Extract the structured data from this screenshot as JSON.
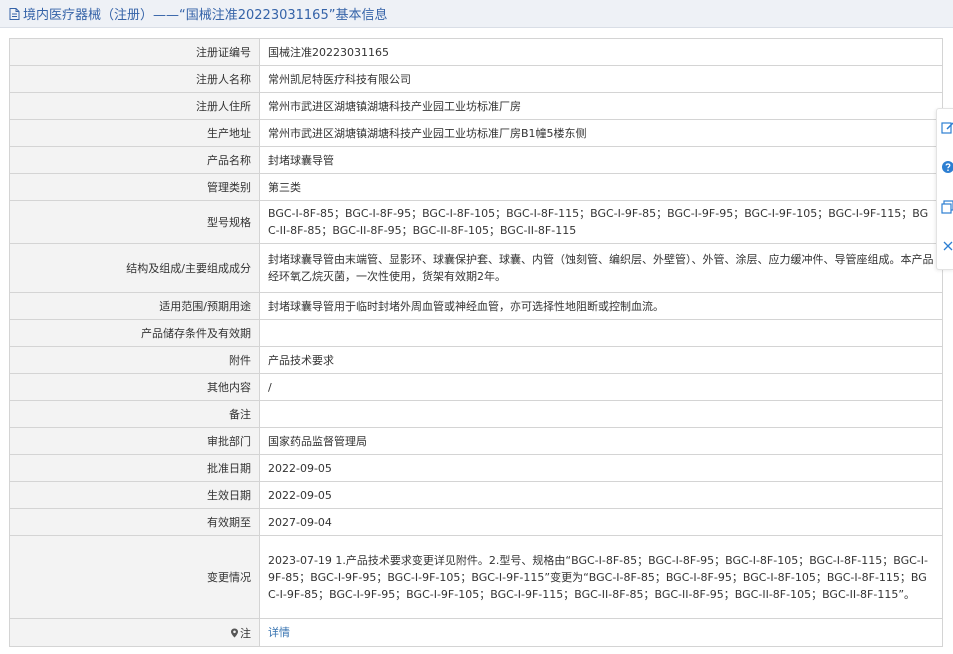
{
  "header": {
    "title": "境内医疗器械（注册）——“国械注准20223031165”基本信息"
  },
  "rows": [
    {
      "label": "注册证编号",
      "value": "国械注准20223031165"
    },
    {
      "label": "注册人名称",
      "value": "常州凯尼特医疗科技有限公司"
    },
    {
      "label": "注册人住所",
      "value": "常州市武进区湖塘镇湖塘科技产业园工业坊标准厂房"
    },
    {
      "label": "生产地址",
      "value": "常州市武进区湖塘镇湖塘科技产业园工业坊标准厂房B1幢5楼东侧"
    },
    {
      "label": "产品名称",
      "value": "封堵球囊导管"
    },
    {
      "label": "管理类别",
      "value": "第三类"
    },
    {
      "label": "型号规格",
      "value": "BGC-I-8F-85；BGC-I-8F-95；BGC-I-8F-105；BGC-I-8F-115；BGC-I-9F-85；BGC-I-9F-95；BGC-I-9F-105；BGC-I-9F-115；BGC-II-8F-85；BGC-II-8F-95；BGC-II-8F-105；BGC-II-8F-115"
    },
    {
      "label": "结构及组成/主要组成成分",
      "value": "封堵球囊导管由末端管、显影环、球囊保护套、球囊、内管（蚀刻管、编织层、外壁管）、外管、涂层、应力缓冲件、导管座组成。本产品经环氧乙烷灭菌，一次性使用，货架有效期2年。"
    },
    {
      "label": "适用范围/预期用途",
      "value": "封堵球囊导管用于临时封堵外周血管或神经血管，亦可选择性地阻断或控制血流。"
    },
    {
      "label": "产品储存条件及有效期",
      "value": ""
    },
    {
      "label": "附件",
      "value": "产品技术要求"
    },
    {
      "label": "其他内容",
      "value": "/"
    },
    {
      "label": "备注",
      "value": ""
    },
    {
      "label": "审批部门",
      "value": "国家药品监督管理局"
    },
    {
      "label": "批准日期",
      "value": "2022-09-05"
    },
    {
      "label": "生效日期",
      "value": "2022-09-05"
    },
    {
      "label": "有效期至",
      "value": "2027-09-04"
    },
    {
      "label": "变更情况",
      "value": "2023-07-19 1.产品技术要求变更详见附件。2.型号、规格由“BGC-I-8F-85；BGC-I-8F-95；BGC-I-8F-105；BGC-I-8F-115；BGC-I-9F-85；BGC-I-9F-95；BGC-I-9F-105；BGC-I-9F-115”变更为“BGC-I-8F-85；BGC-I-8F-95；BGC-I-8F-105；BGC-I-8F-115；BGC-I-9F-85；BGC-I-9F-95；BGC-I-9F-105；BGC-I-9F-115；BGC-II-8F-85；BGC-II-8F-95；BGC-II-8F-105；BGC-II-8F-115”。"
    }
  ],
  "note": {
    "label": "注",
    "link_text": "详情"
  },
  "side_tools": [
    "edit-icon",
    "help-icon",
    "copy-icon",
    "close-icon"
  ],
  "colors": {
    "title": "#3563a8",
    "link": "#3572b0",
    "label_bg": "#f3f3f3",
    "accent": "#2d7fd2"
  }
}
